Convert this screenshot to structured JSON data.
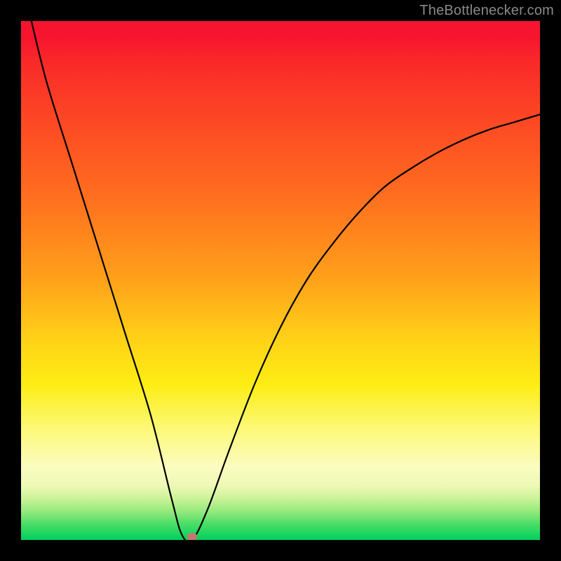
{
  "attribution": "TheBottlenecker.com",
  "chart_data": {
    "type": "line",
    "title": "",
    "xlabel": "",
    "ylabel": "",
    "xlim": [
      0,
      100
    ],
    "ylim": [
      0,
      100
    ],
    "series": [
      {
        "name": "curve",
        "x": [
          2,
          5,
          10,
          15,
          20,
          25,
          29,
          31,
          33,
          36,
          40,
          45,
          50,
          55,
          60,
          65,
          70,
          75,
          80,
          85,
          90,
          95,
          100
        ],
        "values": [
          100,
          88,
          72,
          56,
          40,
          24,
          8,
          1,
          0,
          6,
          17,
          30,
          41,
          50,
          57,
          63,
          68,
          71.5,
          74.5,
          77,
          79,
          80.5,
          82
        ]
      }
    ],
    "annotations": [
      {
        "name": "highlight-marker",
        "x": 33,
        "y": 0
      }
    ],
    "colors": {
      "curve": "#000000",
      "marker": "#c17a6f",
      "gradient_top": "#f7142e",
      "gradient_bottom": "#00d05b"
    }
  }
}
